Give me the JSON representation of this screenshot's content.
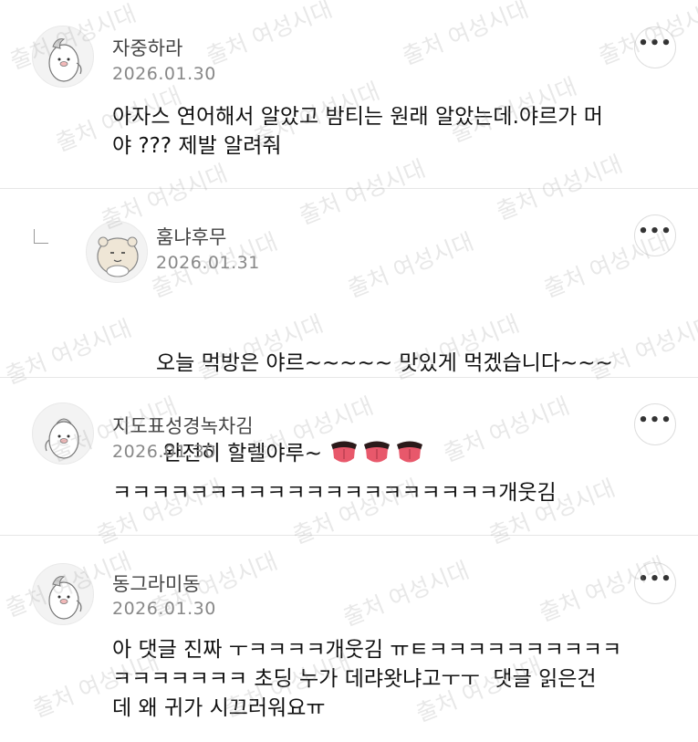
{
  "comments": [
    {
      "nickname": "자중하라",
      "date": "2026.01.30",
      "text": "아자스 연어해서 알았고 밤티는 원래 알았는데.야르가 머\n야 ??? 제발 알려줘",
      "avatar": "penguin-bird-icon",
      "is_reply": false
    },
    {
      "nickname": "훔냐후무",
      "date": "2026.01.31",
      "text_line1": "오늘 먹방은 야르~~~~~ 맛있게 먹겠습니다~~~",
      "text_line2": " 완전히 할렐야루~ ",
      "emoji": "tongue-emoji",
      "avatar": "hamster-icon",
      "is_reply": true
    },
    {
      "nickname": "지도표성경녹차김",
      "date": "2026.01.30",
      "text": "ㅋㅋㅋㅋㅋㅋㅋㅋㅋㅋㅋㅋㅋㅋㅋㅋㅋㅋㅋㅋ개웃김",
      "avatar": "penguin-bird-icon",
      "is_reply": false
    },
    {
      "nickname": "동그라미동",
      "date": "2026.01.30",
      "text": "아 댓글 진짜 ㅜㅋㅋㅋㅋ개웃김 ㅠㅌㅋㅋㅋㅋㅋㅋㅋㅋㅋㅋ\nㅋㅋㅋㅋㅋㅋㅋ 초딩 누가 데랴왓냐고ㅜㅜ  댓글 읽은건\n데 왜 귀가 시끄러워요ㅠ",
      "avatar": "penguin-bird-icon",
      "is_reply": false
    }
  ],
  "more_label": "•••",
  "watermark": "출처 여성시대",
  "colors": {
    "nickname": "#444444",
    "date": "#888888",
    "divider": "#e6e6e6"
  }
}
